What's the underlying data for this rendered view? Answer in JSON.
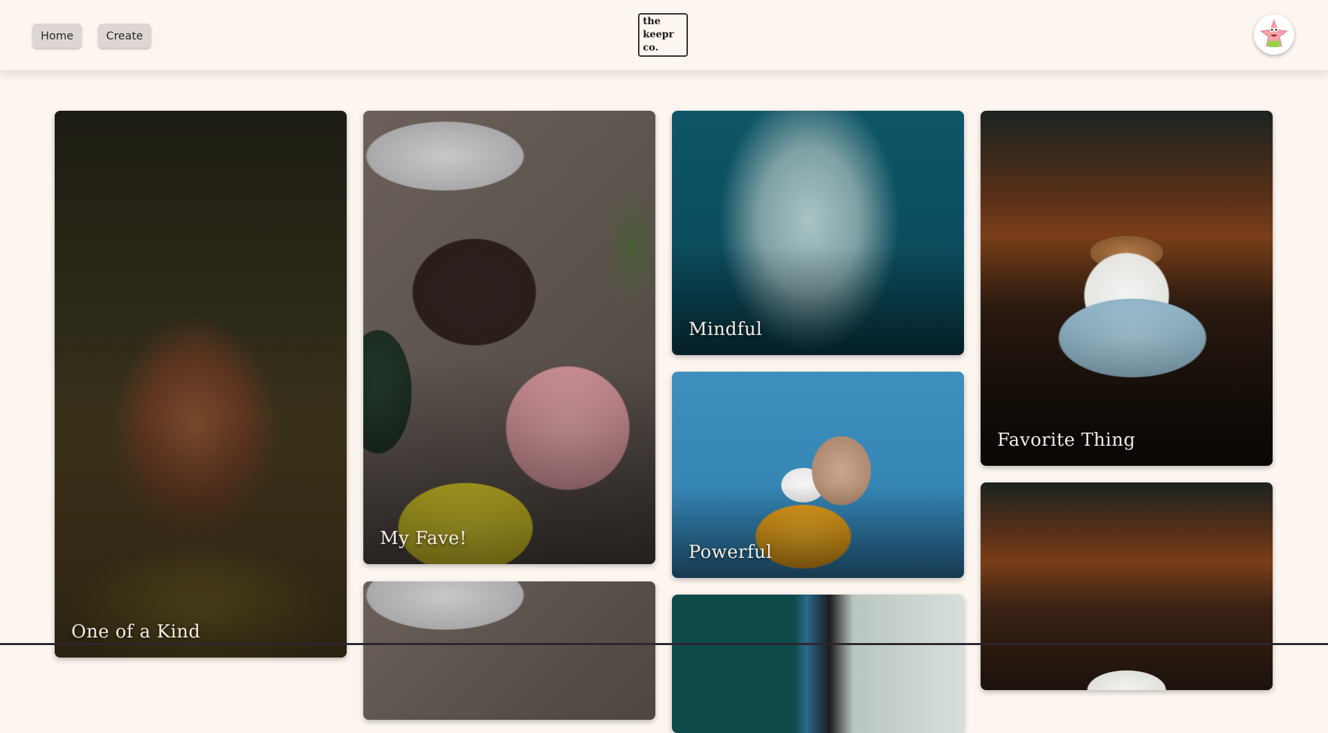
{
  "nav": {
    "home_label": "Home",
    "create_label": "Create"
  },
  "logo": {
    "line1": "the",
    "line2": "keepr",
    "line3": "co."
  },
  "user": {
    "avatar_icon": "patrick-star-avatar-icon"
  },
  "cards": [
    {
      "title": "One of a Kind",
      "image": "brown-bear"
    },
    {
      "title": "My Fave!",
      "image": "beanies-flatlay"
    },
    {
      "title": "",
      "image": "beanies-flatlay"
    },
    {
      "title": "Mindful",
      "image": "statue-head"
    },
    {
      "title": "Powerful",
      "image": "french-bulldog-hoodie"
    },
    {
      "title": "",
      "image": "plant-window"
    },
    {
      "title": "Favorite Thing",
      "image": "coffee-cup"
    },
    {
      "title": "",
      "image": "coffee-cup"
    }
  ],
  "colors": {
    "background": "#fdf6f0",
    "button": "#ddd6d2"
  }
}
